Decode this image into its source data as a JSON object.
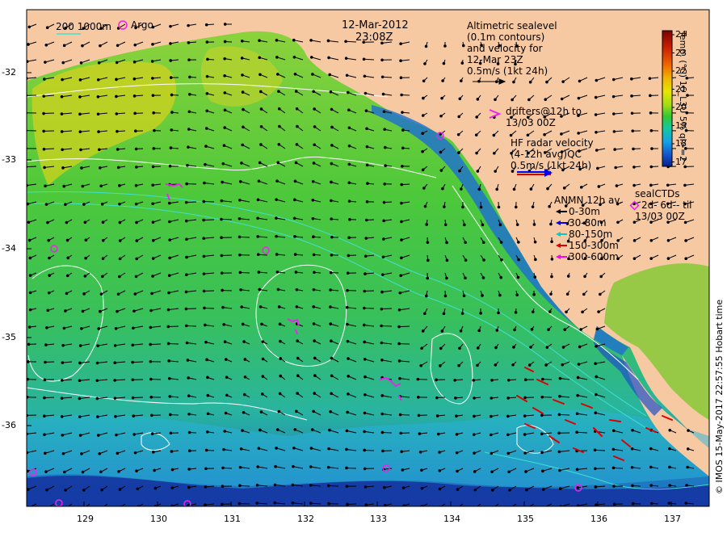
{
  "map": {
    "date": "12-Mar-2012",
    "time": "23:08Z",
    "x_ticks": [
      "129",
      "130",
      "131",
      "132",
      "133",
      "134",
      "135",
      "136",
      "137"
    ],
    "y_ticks": [
      "-32",
      "-33",
      "-34",
      "-35",
      "-36"
    ],
    "credit": "© IMOS 15-May-2017 22:57:55 Hobart time"
  },
  "legend": {
    "isobath": "200  1000m",
    "argo": "Argo",
    "altimetry": [
      "Altimetric sealevel",
      "(0.1m contours)",
      "and velocity for",
      "12-Mar 23Z",
      "0.5m/s (1kt 24h)"
    ],
    "drifters": [
      "drifters@12h to",
      "13/03 00Z"
    ],
    "hf_radar": [
      "HF radar velocity",
      "(4-12h avg)QC",
      "0.5m/s (1kt 24h)"
    ],
    "anmn": {
      "title": "ANMN 12h av.",
      "items": [
        {
          "label": "0-30m",
          "color": "#000000"
        },
        {
          "label": "30-80m",
          "color": "#0000ee"
        },
        {
          "label": "80-150m",
          "color": "#00cccc"
        },
        {
          "label": "150-300m",
          "color": "#dd0000"
        },
        {
          "label": "300-600m",
          "color": "#ff00ff"
        }
      ]
    },
    "sealctds": [
      "sealCTDs",
      "2d- 6d-- til",
      "13/03 00Z"
    ]
  },
  "colorbar": {
    "label": "Temp. (°C) 16_L3U 5% ql>=2",
    "ticks": [
      "24",
      "23",
      "22",
      "21",
      "20",
      "19",
      "18",
      "17"
    ],
    "colors": [
      "#7a0000",
      "#c81e00",
      "#f06400",
      "#f0b400",
      "#e6e600",
      "#a0dc14",
      "#32c832",
      "#14c8a0",
      "#14a0e6",
      "#1450c8",
      "#0a1e8c"
    ]
  },
  "colors": {
    "land": "#f7c9a3",
    "water_mid": "#3cc83c",
    "contour": "#ffffff",
    "isobath": "#40e0d0",
    "argo": "#ee22ee"
  }
}
